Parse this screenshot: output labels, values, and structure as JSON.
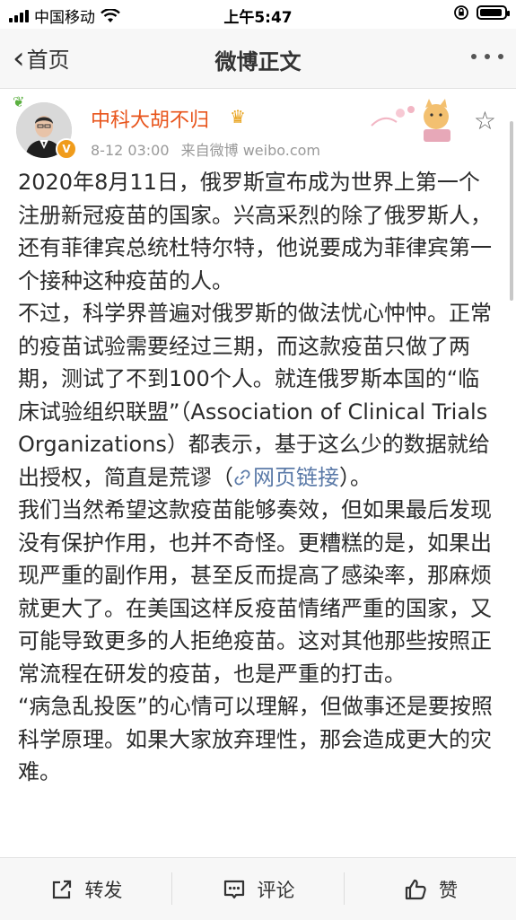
{
  "status_bar": {
    "carrier": "中国移动",
    "time": "上午5:47"
  },
  "nav": {
    "back_label": "首页",
    "title": "微博正文"
  },
  "post": {
    "author": "中科大胡不归",
    "date": "8-12 03:00",
    "source": "来自微博 weibo.com",
    "paragraphs": [
      "2020年8月11日，俄罗斯宣布成为世界上第一个注册新冠疫苗的国家。兴高采烈的除了俄罗斯人，还有菲律宾总统杜特尔特，他说要成为菲律宾第一个接种这种疫苗的人。",
      "不过，科学界普遍对俄罗斯的做法忧心忡忡。正常的疫苗试验需要经过三期，而这款疫苗只做了两期，测试了不到100个人。就连俄罗斯本国的“临床试验组织联盟”（Association of Clinical Trials Organizations）都表示，基于这么少的数据就给出授权，简直是荒谬（",
      "我们当然希望这款疫苗能够奏效，但如果最后发现没有保护作用，也并不奇怪。更糟糕的是，如果出现严重的副作用，甚至反而提高了感染率，那麻烦就更大了。在美国这样反疫苗情绪严重的国家，又可能导致更多的人拒绝疫苗。这对其他那些按照正常流程在研发的疫苗，也是严重的打击。",
      "“病急乱投医”的心情可以理解，但做事还是要按照科学原理。如果大家放弃理性，那会造成更大的灾难。"
    ],
    "link_text": "网页链接",
    "after_link": "）。"
  },
  "actions": {
    "repost": "转发",
    "comment": "评论",
    "like": "赞"
  },
  "colors": {
    "author_name": "#e8541b",
    "link": "#5b7aa8",
    "verified_badge": "#f09c1c"
  }
}
